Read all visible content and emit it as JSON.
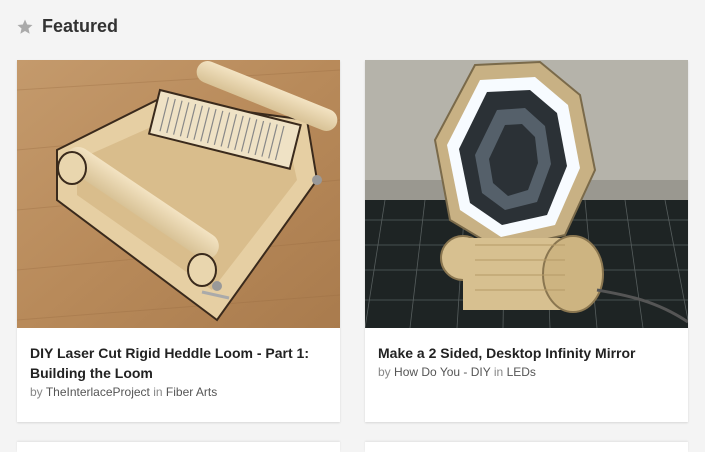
{
  "section": {
    "title": "Featured",
    "icon": "star-icon"
  },
  "cards": [
    {
      "title": "DIY Laser Cut Rigid Heddle Loom - Part 1: Building the Loom",
      "by_label": "by",
      "author": "TheInterlaceProject",
      "in_label": "in",
      "category": "Fiber Arts",
      "image": "laser-cut-loom-photo"
    },
    {
      "title": "Make a 2 Sided, Desktop Infinity Mirror",
      "by_label": "by",
      "author": "How Do You - DIY",
      "in_label": "in",
      "category": "LEDs",
      "image": "infinity-mirror-photo"
    }
  ],
  "colors": {
    "background": "#f4f4f4",
    "card": "#ffffff",
    "title_text": "#222222",
    "meta_text": "#888888",
    "star": "#aaaaaa"
  }
}
